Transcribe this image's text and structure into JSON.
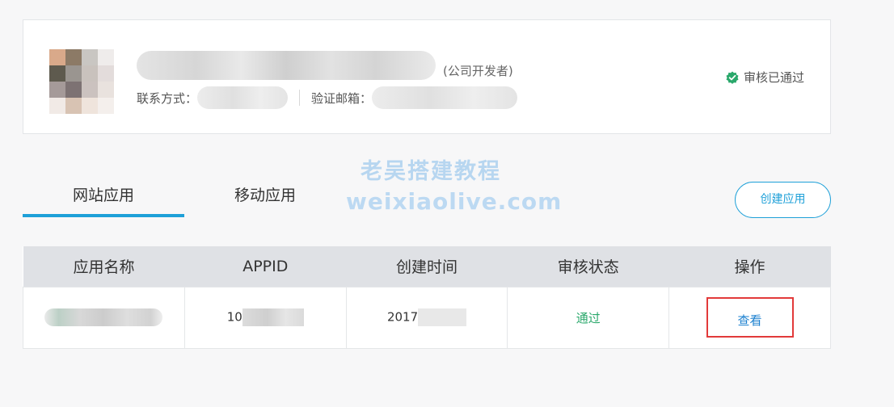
{
  "profile": {
    "developer_type": "(公司开发者)",
    "contact_label": "联系方式：",
    "email_label": "验证邮箱：",
    "status_text": "审核已通过"
  },
  "watermark": {
    "line1": "老吴搭建教程",
    "line2": "weixiaolive.com"
  },
  "tabs": [
    {
      "label": "网站应用",
      "active": true
    },
    {
      "label": "移动应用",
      "active": false
    }
  ],
  "create_button": "创建应用",
  "table": {
    "headers": [
      "应用名称",
      "APPID",
      "创建时间",
      "审核状态",
      "操作"
    ],
    "rows": [
      {
        "appid_prefix": "10",
        "created_prefix": "2017",
        "status": "通过",
        "action": "查看"
      }
    ]
  },
  "colors": {
    "accent": "#1ea0d8",
    "success": "#2aa86b",
    "highlight_border": "#e23a3a",
    "header_bg": "#dfe1e5"
  }
}
